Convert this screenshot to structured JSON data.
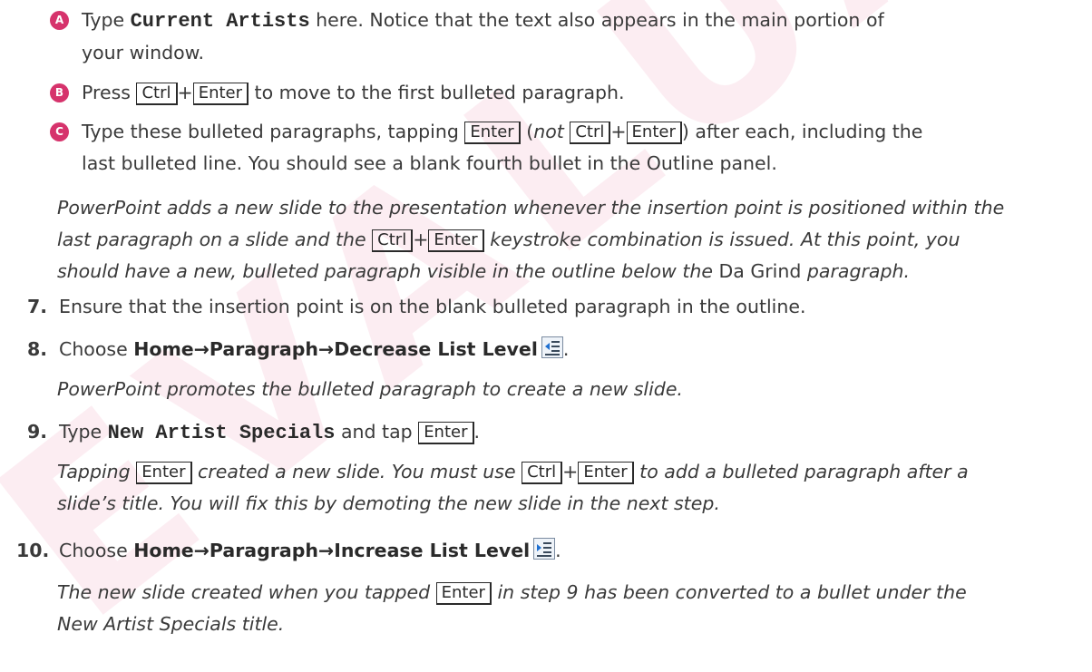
{
  "watermark": "EVALUA",
  "substeps": [
    {
      "badge": "A",
      "line1": [
        "Type ",
        "Current Artists",
        " here. Notice that the text also appears in the main portion of"
      ],
      "line2": "your window."
    },
    {
      "badge": "B",
      "parts": [
        "Press ",
        "Ctrl",
        "+",
        "Enter",
        " to move to the first bulleted paragraph."
      ]
    },
    {
      "badge": "C",
      "line1": [
        "Type these bulleted paragraphs, tapping ",
        "Enter",
        " (",
        "not",
        " ",
        "Ctrl",
        "+",
        "Enter",
        ") after each, including the"
      ],
      "line2": "last bulleted line. You should see a blank fourth bullet in the Outline panel."
    }
  ],
  "note1": {
    "line1": "PowerPoint adds a new slide to the presentation whenever the insertion point is positioned within the",
    "line2": [
      "last paragraph on a slide and the ",
      "Ctrl",
      "+",
      "Enter",
      " keystroke combination is issued. At this point, you"
    ],
    "line3": [
      "should have a new, bulleted paragraph visible in the outline below the ",
      "Da Grind",
      " paragraph."
    ]
  },
  "steps": {
    "s7": {
      "num": "7.",
      "text": "Ensure that the insertion point is on the blank bulleted paragraph in the outline."
    },
    "s8": {
      "num": "8.",
      "pre": "Choose ",
      "cmd": "Home→Paragraph→Decrease List Level",
      "post": ".",
      "icon": "decrease-list-level-icon"
    },
    "s8note": "PowerPoint promotes the bulleted paragraph to create a new slide.",
    "s9": {
      "num": "9.",
      "pre": "Type ",
      "mono": "New Artist Specials",
      "mid": " and tap ",
      "key": "Enter",
      "post": "."
    },
    "s9note": {
      "line1": [
        "Tapping ",
        "Enter",
        " created a new slide. You must use ",
        "Ctrl",
        "+",
        "Enter",
        " to add a bulleted paragraph after a"
      ],
      "line2": "slide’s title. You will fix this by demoting the new slide in the next step."
    },
    "s10": {
      "num": "10.",
      "pre": "Choose ",
      "cmd": "Home→Paragraph→Increase List Level",
      "post": ".",
      "icon": "increase-list-level-icon"
    },
    "s10note": {
      "line1": [
        "The new slide created when you tapped ",
        "Enter",
        " in step 9 has been converted to a bullet under the"
      ],
      "line2": "New Artist Specials title."
    }
  }
}
